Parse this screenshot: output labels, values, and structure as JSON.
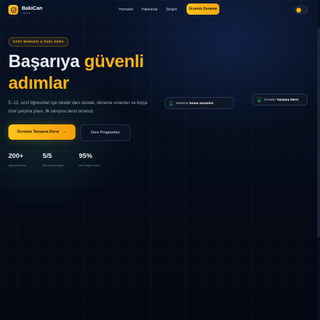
{
  "brand": {
    "name": "BakiCan",
    "sub": ".com.tr"
  },
  "nav": {
    "links": [
      "Hizmetler",
      "Hakkımda",
      "İletişim"
    ],
    "cta": "Ücretsiz Deneme"
  },
  "hero": {
    "badge": "ETÜT MERKEZİ & ÖZEL DERS",
    "title_line1_a": "Başarıya ",
    "title_line1_b": "güvenli",
    "title_line2": "adımlar",
    "lead": "5.-12. sınıf öğrencileri için birebir ders destek, deneme sınavları ve kişiye özel çalışma planı. İlk tanışma dersi ücretsiz.",
    "primary_cta": "Ücretsiz Tanışma Dersi",
    "primary_arrow": "→",
    "secondary_cta": "Ders Programları"
  },
  "stats": [
    {
      "value": "200+",
      "label": "öğrenci birebir"
    },
    {
      "value": "5/5",
      "label": "veli memnuniyeti"
    },
    {
      "value": "95%",
      "label": "okul başarı oranı"
    }
  ],
  "floating": {
    "card1_prefix": "Deneme ",
    "card1_bold": "Sınavı Garantisi",
    "card2_prefix": "Ücretsiz ",
    "card2_bold": "Tanışma Dersi"
  },
  "colors": {
    "accent": "#f5b014",
    "background": "#050a16",
    "check": "#22c55e"
  }
}
